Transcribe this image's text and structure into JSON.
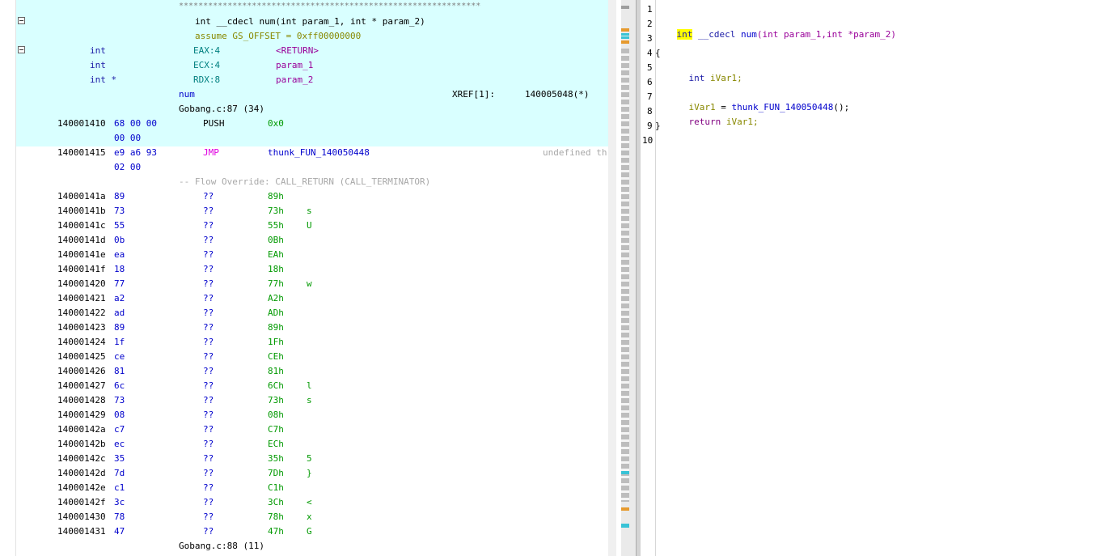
{
  "listing": {
    "stars": "**************************************************************",
    "signature": "int __cdecl num(int param_1, int * param_2)",
    "assume": "assume GS_OFFSET = 0xff00000000",
    "vars": [
      {
        "type": "int",
        "storage": "EAX:4",
        "name": "<RETURN>"
      },
      {
        "type": "int",
        "storage": "ECX:4",
        "name": "param_1"
      },
      {
        "type": "int *",
        "storage": "RDX:8",
        "name": "param_2"
      }
    ],
    "func_label": "num",
    "xref_label": "XREF[1]:",
    "xref_addr": "140005048(*)",
    "source_line_1": "Gobang.c:87 (34)",
    "push": {
      "addr": "140001410",
      "bytes1": "68 00 00",
      "bytes2": "00 00",
      "mnemonic": "PUSH",
      "operand": "0x0"
    },
    "jmp": {
      "addr": "140001415",
      "bytes1": "e9 a6 93",
      "bytes2": "02 00",
      "mnemonic": "JMP",
      "operand": "thunk_FUN_140050448",
      "comment": "undefined th"
    },
    "flow_override": "-- Flow Override: CALL_RETURN (CALL_TERMINATOR)",
    "rows": [
      {
        "addr": "14000141a",
        "byte": "89",
        "mn": "??",
        "val": "89h",
        "ch": ""
      },
      {
        "addr": "14000141b",
        "byte": "73",
        "mn": "??",
        "val": "73h",
        "ch": "s"
      },
      {
        "addr": "14000141c",
        "byte": "55",
        "mn": "??",
        "val": "55h",
        "ch": "U"
      },
      {
        "addr": "14000141d",
        "byte": "0b",
        "mn": "??",
        "val": "0Bh",
        "ch": ""
      },
      {
        "addr": "14000141e",
        "byte": "ea",
        "mn": "??",
        "val": "EAh",
        "ch": ""
      },
      {
        "addr": "14000141f",
        "byte": "18",
        "mn": "??",
        "val": "18h",
        "ch": ""
      },
      {
        "addr": "140001420",
        "byte": "77",
        "mn": "??",
        "val": "77h",
        "ch": "w"
      },
      {
        "addr": "140001421",
        "byte": "a2",
        "mn": "??",
        "val": "A2h",
        "ch": ""
      },
      {
        "addr": "140001422",
        "byte": "ad",
        "mn": "??",
        "val": "ADh",
        "ch": ""
      },
      {
        "addr": "140001423",
        "byte": "89",
        "mn": "??",
        "val": "89h",
        "ch": ""
      },
      {
        "addr": "140001424",
        "byte": "1f",
        "mn": "??",
        "val": "1Fh",
        "ch": ""
      },
      {
        "addr": "140001425",
        "byte": "ce",
        "mn": "??",
        "val": "CEh",
        "ch": ""
      },
      {
        "addr": "140001426",
        "byte": "81",
        "mn": "??",
        "val": "81h",
        "ch": ""
      },
      {
        "addr": "140001427",
        "byte": "6c",
        "mn": "??",
        "val": "6Ch",
        "ch": "l"
      },
      {
        "addr": "140001428",
        "byte": "73",
        "mn": "??",
        "val": "73h",
        "ch": "s"
      },
      {
        "addr": "140001429",
        "byte": "08",
        "mn": "??",
        "val": "08h",
        "ch": ""
      },
      {
        "addr": "14000142a",
        "byte": "c7",
        "mn": "??",
        "val": "C7h",
        "ch": ""
      },
      {
        "addr": "14000142b",
        "byte": "ec",
        "mn": "??",
        "val": "ECh",
        "ch": ""
      },
      {
        "addr": "14000142c",
        "byte": "35",
        "mn": "??",
        "val": "35h",
        "ch": "5"
      },
      {
        "addr": "14000142d",
        "byte": "7d",
        "mn": "??",
        "val": "7Dh",
        "ch": "}"
      },
      {
        "addr": "14000142e",
        "byte": "c1",
        "mn": "??",
        "val": "C1h",
        "ch": ""
      },
      {
        "addr": "14000142f",
        "byte": "3c",
        "mn": "??",
        "val": "3Ch",
        "ch": "<"
      },
      {
        "addr": "140001430",
        "byte": "78",
        "mn": "??",
        "val": "78h",
        "ch": "x"
      },
      {
        "addr": "140001431",
        "byte": "47",
        "mn": "??",
        "val": "47h",
        "ch": "G"
      }
    ],
    "source_line_2": "Gobang.c:88 (11)"
  },
  "decompiler": {
    "line_numbers": [
      "1",
      "2",
      "3",
      "4",
      "5",
      "6",
      "7",
      "8",
      "9",
      "10"
    ],
    "sig": {
      "ret": "int",
      "cc": "__cdecl",
      "fn": "num",
      "args": "(int param_1,int *param_2)"
    },
    "open_brace": "{",
    "decl": {
      "type": "int",
      "name": "iVar1;"
    },
    "assign": {
      "lhs": "iVar1",
      "eq": " = ",
      "call": "thunk_FUN_140050448",
      "tail": "();"
    },
    "ret": {
      "kw": "return",
      "val": "iVar1;"
    },
    "close_brace": "}"
  },
  "colors": {
    "highlight_bg": "#d9ffff",
    "cursor_bg": "#ffff00"
  }
}
